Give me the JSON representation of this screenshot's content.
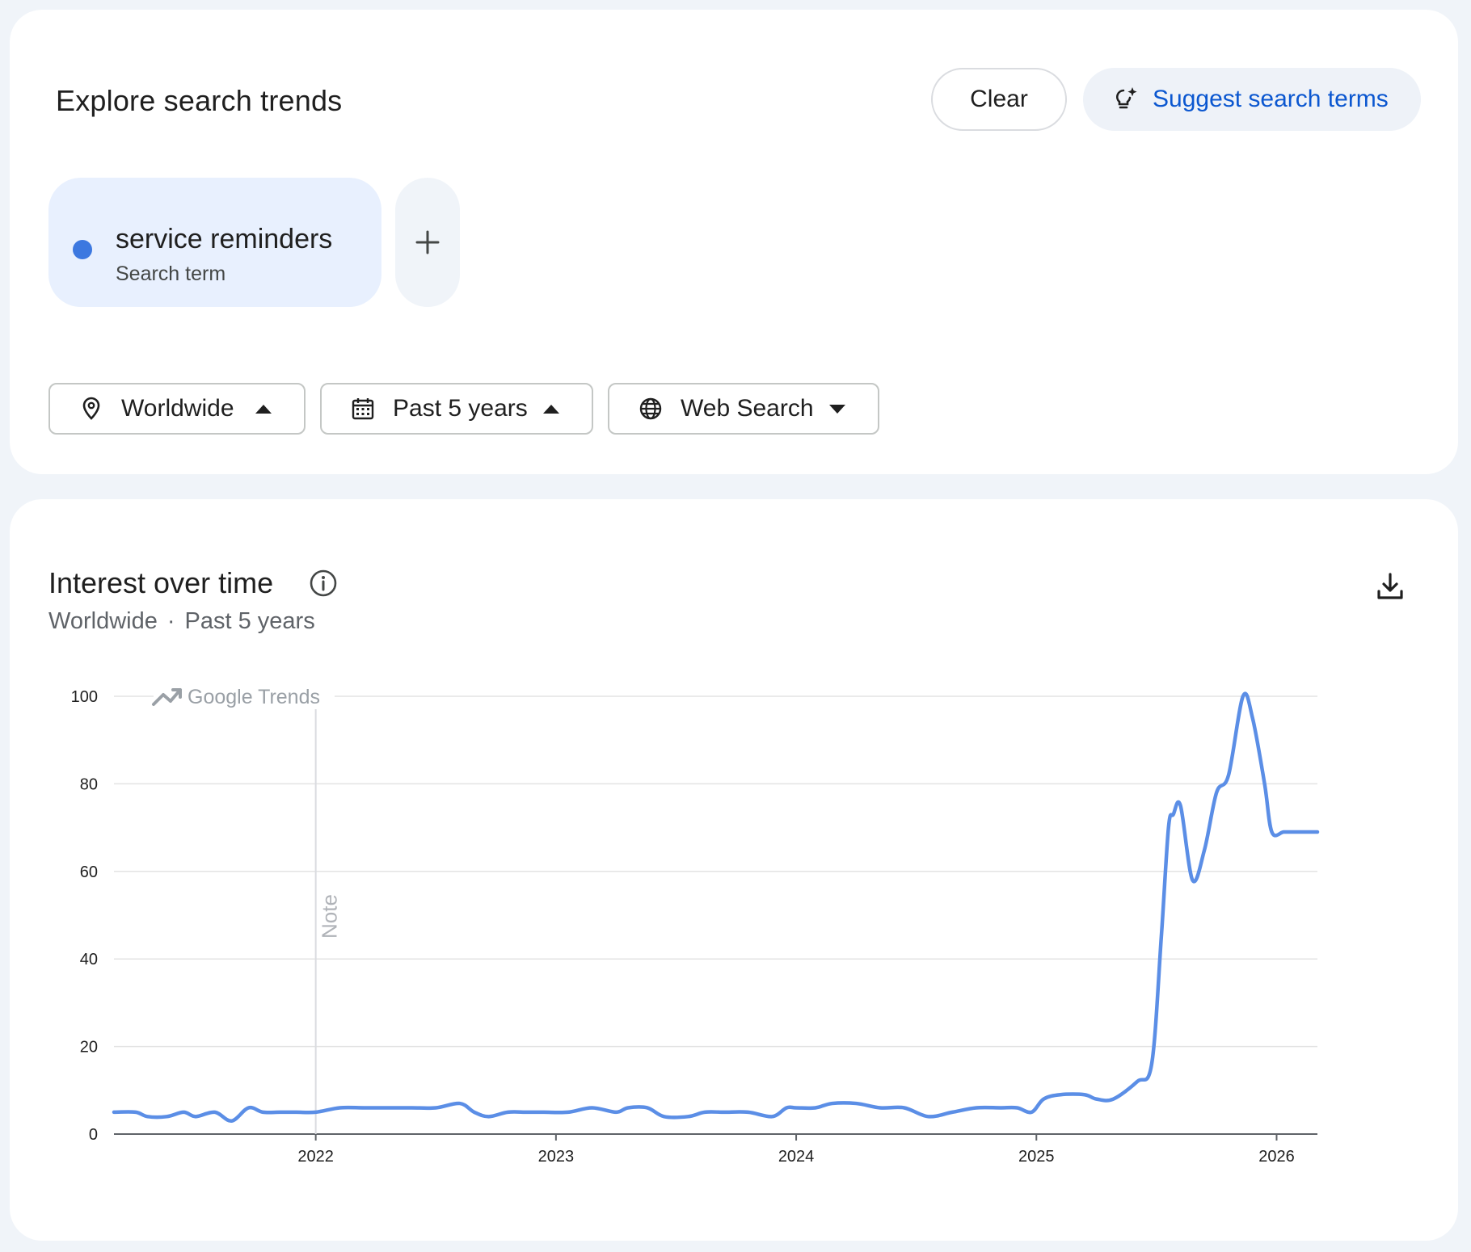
{
  "explore": {
    "title": "Explore search trends",
    "clear_label": "Clear",
    "suggest_label": "Suggest search terms"
  },
  "term_chip": {
    "term": "service reminders",
    "type": "Search term",
    "color": "#3c78e0"
  },
  "add_icon": "plus-icon",
  "filters": {
    "region": "Worldwide",
    "time": "Past 5 years",
    "property": "Web Search"
  },
  "interest": {
    "title": "Interest over time",
    "region": "Worldwide",
    "separator": "·",
    "time": "Past 5 years",
    "watermark": "Google Trends",
    "note_label": "Note"
  },
  "colors": {
    "accent": "#0b57d0",
    "series": "#5b8ee6",
    "chip_bg": "#e8f0fe"
  },
  "chart_data": {
    "type": "line",
    "ylim": [
      0,
      100
    ],
    "y_ticks": [
      0,
      20,
      40,
      60,
      80,
      100
    ],
    "x_ticks": [
      "2022",
      "2023",
      "2024",
      "2025",
      "2026"
    ],
    "x_tick_values": [
      2022.0,
      2023.0,
      2024.0,
      2025.0,
      2026.0
    ],
    "xlim": [
      2021.16,
      2026.17
    ],
    "note_x": 2022.0,
    "grid": true,
    "series": [
      {
        "x": [
          2021.16,
          2021.25,
          2021.3,
          2021.38,
          2021.45,
          2021.5,
          2021.58,
          2021.65,
          2021.72,
          2021.78,
          2021.85,
          2021.92,
          2022.0,
          2022.1,
          2022.2,
          2022.3,
          2022.4,
          2022.5,
          2022.6,
          2022.66,
          2022.72,
          2022.8,
          2022.88,
          2022.95,
          2023.05,
          2023.15,
          2023.25,
          2023.3,
          2023.38,
          2023.45,
          2023.55,
          2023.62,
          2023.7,
          2023.8,
          2023.9,
          2023.96,
          2024.0,
          2024.08,
          2024.15,
          2024.25,
          2024.35,
          2024.45,
          2024.55,
          2024.65,
          2024.75,
          2024.85,
          2024.92,
          2024.98,
          2025.03,
          2025.1,
          2025.2,
          2025.25,
          2025.32,
          2025.42,
          2025.48,
          2025.52,
          2025.55,
          2025.57,
          2025.6,
          2025.65,
          2025.7,
          2025.75,
          2025.8,
          2025.86,
          2025.9,
          2025.95,
          2025.98,
          2026.03,
          2026.08,
          2026.12,
          2026.17
        ],
        "values": [
          5,
          5,
          4,
          4,
          5,
          4,
          5,
          3,
          6,
          5,
          5,
          5,
          5,
          6,
          6,
          6,
          6,
          6,
          7,
          5,
          4,
          5,
          5,
          5,
          5,
          6,
          5,
          6,
          6,
          4,
          4,
          5,
          5,
          5,
          4,
          6,
          6,
          6,
          7,
          7,
          6,
          6,
          4,
          5,
          6,
          6,
          6,
          5,
          8,
          9,
          9,
          8,
          8,
          12,
          16,
          45,
          70,
          73,
          75,
          58,
          65,
          78,
          82,
          100,
          95,
          80,
          69,
          69,
          69,
          69,
          69
        ]
      }
    ]
  }
}
